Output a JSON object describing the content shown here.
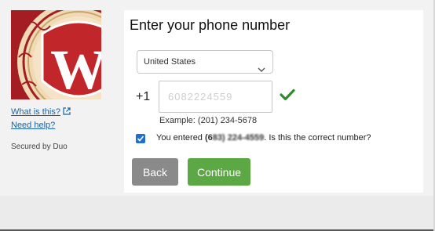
{
  "sidebar": {
    "what_is_this": "What is this?",
    "need_help": "Need help?",
    "secured_by": "Secured by Duo"
  },
  "form": {
    "title": "Enter your phone number",
    "country_selected": "United States",
    "country_code": "+1",
    "phone_value": "6082224559",
    "example": "Example: (201) 234-5678",
    "confirm_prefix": "You entered ",
    "confirm_number_visible": "(6",
    "confirm_number_blurred": "83) 224-4559",
    "confirm_suffix": ". Is this the correct number?",
    "confirm_checked": true
  },
  "buttons": {
    "back": "Back",
    "continue": "Continue"
  },
  "colors": {
    "logo_red": "#a31d22",
    "back_button": "#8a8a8a",
    "continue_button": "#5ba845",
    "check_green": "#2e8b2e",
    "link": "#1a63a8"
  },
  "icons": {
    "logo": "uw-crest-logo",
    "external": "external-link-icon",
    "dropdown": "chevron-down-icon",
    "valid": "checkmark-icon"
  }
}
